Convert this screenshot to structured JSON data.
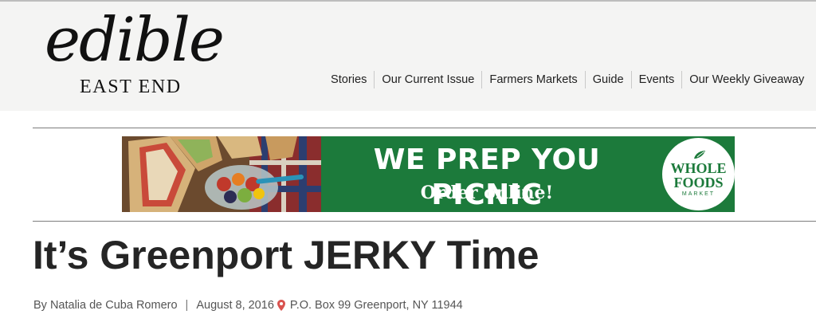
{
  "logo": {
    "wordmark": "edible",
    "subline": "EAST END"
  },
  "nav": {
    "items": [
      {
        "label": "Stories"
      },
      {
        "label": "Our Current Issue"
      },
      {
        "label": "Farmers Markets"
      },
      {
        "label": "Guide"
      },
      {
        "label": "Events"
      },
      {
        "label": "Our Weekly Giveaway"
      }
    ]
  },
  "ad": {
    "headline": "WE PREP YOU PICNIC",
    "subline": "Order online!",
    "badge": {
      "line1": "WHOLE",
      "line2": "FOODS",
      "line3": "MARKET"
    },
    "colors": {
      "background": "#1c7a3b",
      "text": "#ffffff"
    }
  },
  "article": {
    "title": "It’s Greenport JERKY Time",
    "author": "By Natalia de Cuba Romero",
    "separator": "|",
    "date": "August 8, 2016",
    "location_icon": "map-pin-icon",
    "location": "P.O. Box 99 Greenport, NY 11944"
  },
  "colors": {
    "header_background": "#f4f4f3",
    "pin": "#d9534f",
    "title": "#252525"
  }
}
